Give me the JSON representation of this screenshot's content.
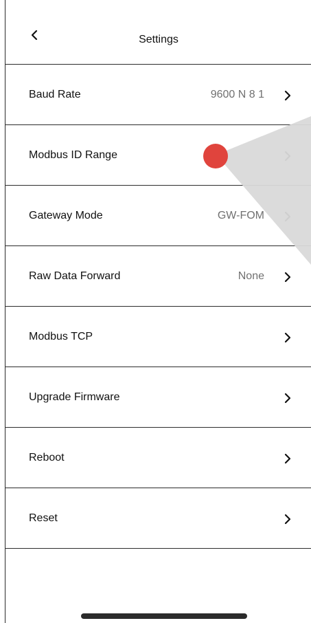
{
  "app": {
    "title": "Settings"
  },
  "icons": {
    "back": "chevron-left-icon",
    "row_chevron": "chevron-right-icon"
  },
  "colors": {
    "pointer": "#e0443d",
    "divider": "#2b2b2b",
    "value_text": "#707070"
  },
  "settings": {
    "items": [
      {
        "label": "Baud Rate",
        "value": "9600 N 8 1"
      },
      {
        "label": "Modbus ID Range",
        "value": ""
      },
      {
        "label": "Gateway Mode",
        "value": "GW-FOM"
      },
      {
        "label": "Raw Data Forward",
        "value": "None"
      },
      {
        "label": "Modbus TCP",
        "value": ""
      },
      {
        "label": "Upgrade Firmware",
        "value": ""
      },
      {
        "label": "Reboot",
        "value": ""
      },
      {
        "label": "Reset",
        "value": ""
      }
    ]
  }
}
